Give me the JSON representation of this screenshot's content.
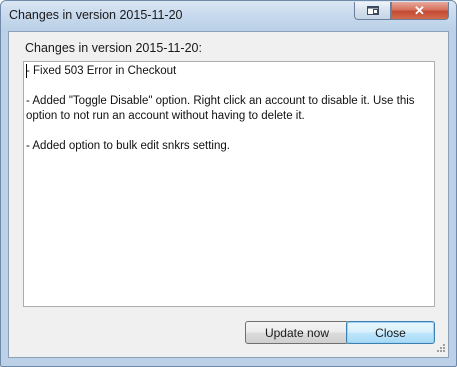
{
  "window": {
    "title": "Changes in version 2015-11-20"
  },
  "dialog": {
    "heading": "Changes in version 2015-11-20:",
    "changes_text": "- Fixed 503 Error in Checkout\n\n- Added \"Toggle Disable\" option. Right click an account to disable it. Use this option to not run an account without having to delete it.\n\n- Added option to bulk edit snkrs setting.",
    "buttons": {
      "update_now": "Update now",
      "close": "Close"
    }
  },
  "colors": {
    "frame": "#bcd1e8",
    "close_button": "#c34a33",
    "default_button_border": "#3c7fb1"
  },
  "icons": [
    "restore-icon",
    "close-icon",
    "resize-grip-icon"
  ]
}
